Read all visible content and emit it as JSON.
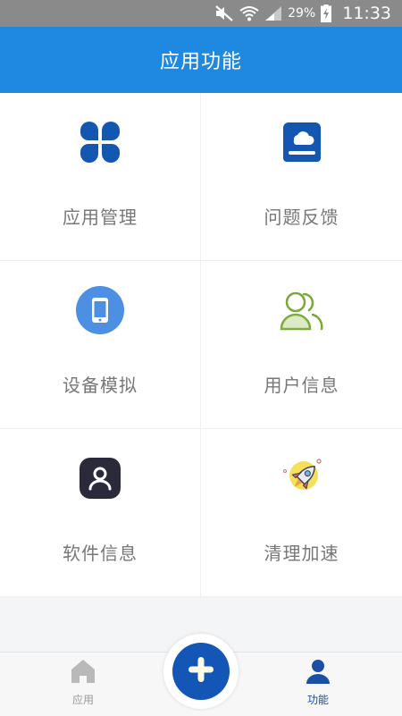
{
  "status_bar": {
    "battery": "29%",
    "time": "11:33",
    "icons": [
      "mute-icon",
      "wifi-icon",
      "signal-icon",
      "battery-charging-icon"
    ]
  },
  "app_bar": {
    "title": "应用功能",
    "color": "#1f88e0"
  },
  "grid": {
    "items": [
      {
        "label": "应用管理",
        "icon": "app-grid-icon"
      },
      {
        "label": "问题反馈",
        "icon": "feedback-icon"
      },
      {
        "label": "设备模拟",
        "icon": "phone-icon"
      },
      {
        "label": "用户信息",
        "icon": "users-icon"
      },
      {
        "label": "软件信息",
        "icon": "person-icon"
      },
      {
        "label": "清理加速",
        "icon": "rocket-icon"
      }
    ]
  },
  "bottom_nav": {
    "items": [
      {
        "label": "应用",
        "icon": "home-icon",
        "active": false
      },
      {
        "label": "功能",
        "icon": "user-icon",
        "active": true
      }
    ],
    "fab_icon": "plus-icon",
    "active_color": "#1a4fa8"
  }
}
